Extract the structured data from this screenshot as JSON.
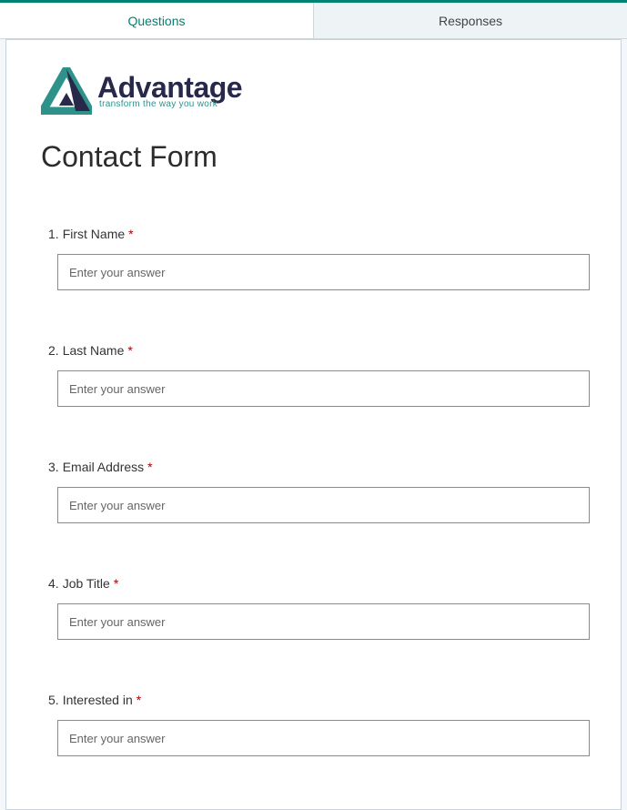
{
  "tabs": {
    "questions": "Questions",
    "responses": "Responses"
  },
  "logo": {
    "word": "Advantage",
    "tagline": "transform the way you work"
  },
  "formTitle": "Contact Form",
  "requiredMark": "*",
  "placeholder": "Enter your answer",
  "questions": [
    {
      "num": "1.",
      "label": "First Name"
    },
    {
      "num": "2.",
      "label": "Last Name"
    },
    {
      "num": "3.",
      "label": "Email Address"
    },
    {
      "num": "4.",
      "label": "Job Title"
    },
    {
      "num": "5.",
      "label": "Interested in"
    }
  ]
}
